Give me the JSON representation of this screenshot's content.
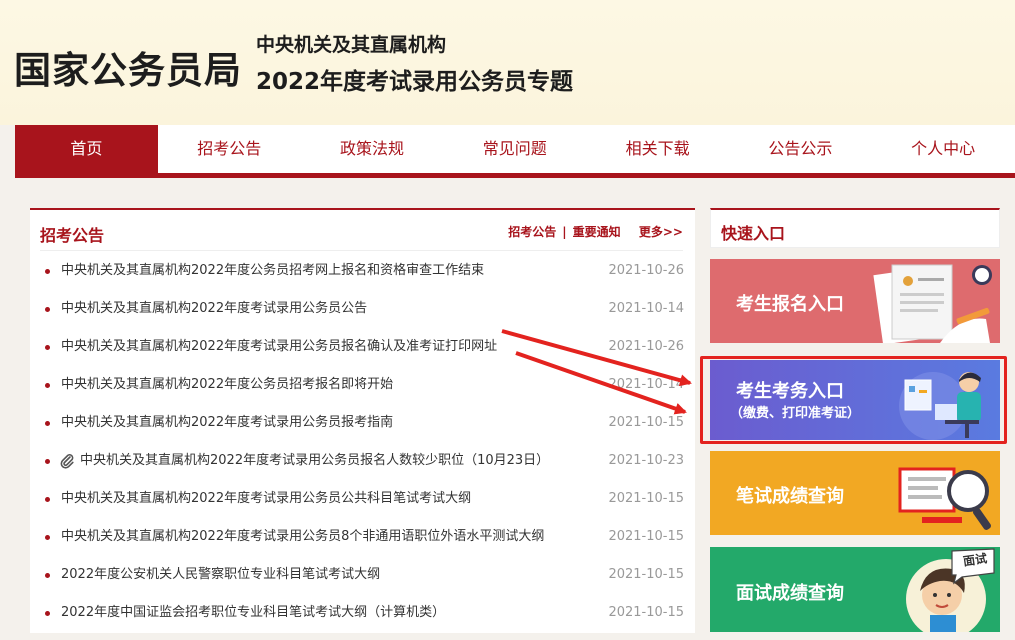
{
  "header": {
    "site_name": "国家公务员局",
    "subtitle_1": "中央机关及其直属机构",
    "subtitle_2": "2022年度考试录用公务员专题"
  },
  "nav": {
    "items": [
      "首页",
      "招考公告",
      "政策法规",
      "常见问题",
      "相关下载",
      "公告公示",
      "个人中心"
    ],
    "active_index": 0
  },
  "notices": {
    "title": "招考公告",
    "links": [
      "招考公告",
      "重要通知"
    ],
    "separator": "|",
    "more": "更多>>",
    "items": [
      {
        "title": "中央机关及其直属机构2022年度公务员招考网上报名和资格审查工作结束",
        "date": "2021-10-26",
        "attachment": false
      },
      {
        "title": "中央机关及其直属机构2022年度考试录用公务员公告",
        "date": "2021-10-14",
        "attachment": false
      },
      {
        "title": "中央机关及其直属机构2022年度考试录用公务员报名确认及准考证打印网址",
        "date": "2021-10-26",
        "attachment": false
      },
      {
        "title": "中央机关及其直属机构2022年度公务员招考报名即将开始",
        "date": "2021-10-14",
        "attachment": false
      },
      {
        "title": "中央机关及其直属机构2022年度考试录用公务员报考指南",
        "date": "2021-10-15",
        "attachment": false
      },
      {
        "title": "中央机关及其直属机构2022年度考试录用公务员报名人数较少职位（10月23日）",
        "date": "2021-10-23",
        "attachment": true
      },
      {
        "title": "中央机关及其直属机构2022年度考试录用公务员公共科目笔试考试大纲",
        "date": "2021-10-15",
        "attachment": false
      },
      {
        "title": "中央机关及其直属机构2022年度考试录用公务员8个非通用语职位外语水平测试大纲",
        "date": "2021-10-15",
        "attachment": false
      },
      {
        "title": "2022年度公安机关人民警察职位专业科目笔试考试大纲",
        "date": "2021-10-15",
        "attachment": false
      },
      {
        "title": "2022年度中国证监会招考职位专业科目笔试考试大纲（计算机类）",
        "date": "2021-10-15",
        "attachment": false
      }
    ]
  },
  "quick": {
    "title": "快速入口",
    "buttons": [
      {
        "label": "考生报名入口",
        "icon": "application-form-icon"
      },
      {
        "label": "考生考务入口",
        "sub": "（缴费、打印准考证）",
        "icon": "computer-user-icon"
      },
      {
        "label": "笔试成绩查询",
        "icon": "magnifier-document-icon"
      },
      {
        "label": "面试成绩查询",
        "bubble": "面试",
        "icon": "interviewee-icon"
      }
    ]
  },
  "colors": {
    "brand_red": "#a8141c",
    "annotation_red": "#e3231f"
  }
}
